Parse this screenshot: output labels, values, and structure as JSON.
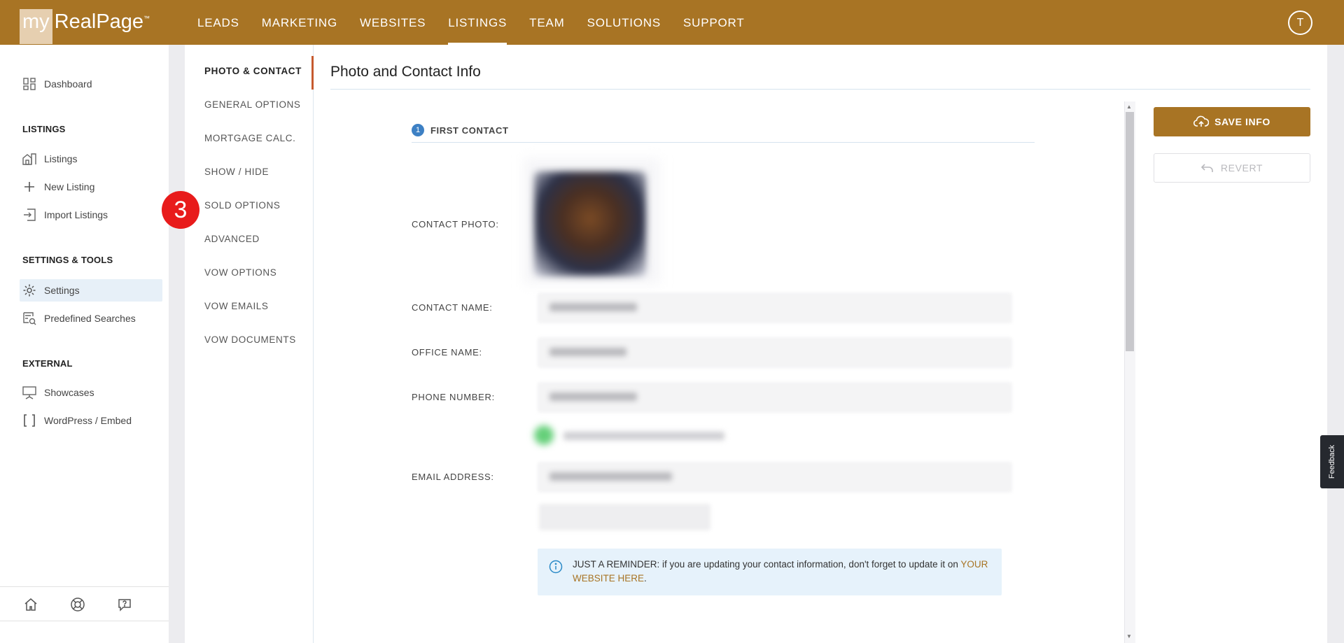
{
  "brand": {
    "my": "my",
    "name": "RealPage",
    "tm": "™"
  },
  "topnav": {
    "items": [
      {
        "label": "LEADS"
      },
      {
        "label": "MARKETING"
      },
      {
        "label": "WEBSITES"
      },
      {
        "label": "LISTINGS",
        "active": true
      },
      {
        "label": "TEAM"
      },
      {
        "label": "SOLUTIONS"
      },
      {
        "label": "SUPPORT"
      }
    ],
    "avatar_initial": "T"
  },
  "sidebar": {
    "dashboard": "Dashboard",
    "listings_heading": "LISTINGS",
    "listings": "Listings",
    "new_listing": "New Listing",
    "import_listings": "Import Listings",
    "settings_heading": "SETTINGS & TOOLS",
    "settings": "Settings",
    "predefined_searches": "Predefined Searches",
    "external_heading": "EXTERNAL",
    "showcases": "Showcases",
    "wordpress": "WordPress / Embed"
  },
  "subnav": {
    "items": [
      "PHOTO & CONTACT",
      "GENERAL OPTIONS",
      "MORTGAGE CALC.",
      "SHOW / HIDE",
      "SOLD OPTIONS",
      "ADVANCED",
      "VOW OPTIONS",
      "VOW EMAILS",
      "VOW DOCUMENTS"
    ],
    "active_index": 0
  },
  "step_badge": "3",
  "main": {
    "title": "Photo and Contact Info",
    "section_number": "1",
    "section_label": "FIRST CONTACT",
    "labels": {
      "photo": "CONTACT PHOTO:",
      "name": "CONTACT NAME:",
      "office": "OFFICE NAME:",
      "phone": "PHONE NUMBER:",
      "email": "EMAIL ADDRESS:"
    },
    "reminder_prefix": "JUST A REMINDER",
    "reminder_text": ": if you are updating your contact information, don't forget to update it on",
    "reminder_link": "YOUR WEBSITE HERE",
    "reminder_end": "."
  },
  "actions": {
    "save": "SAVE INFO",
    "revert": "REVERT"
  },
  "feedback": "Feedback",
  "colors": {
    "brand": "#a87424",
    "accent_blue": "#3d80c4",
    "active_marker": "#c65a2f",
    "badge_red": "#e81b1b"
  }
}
